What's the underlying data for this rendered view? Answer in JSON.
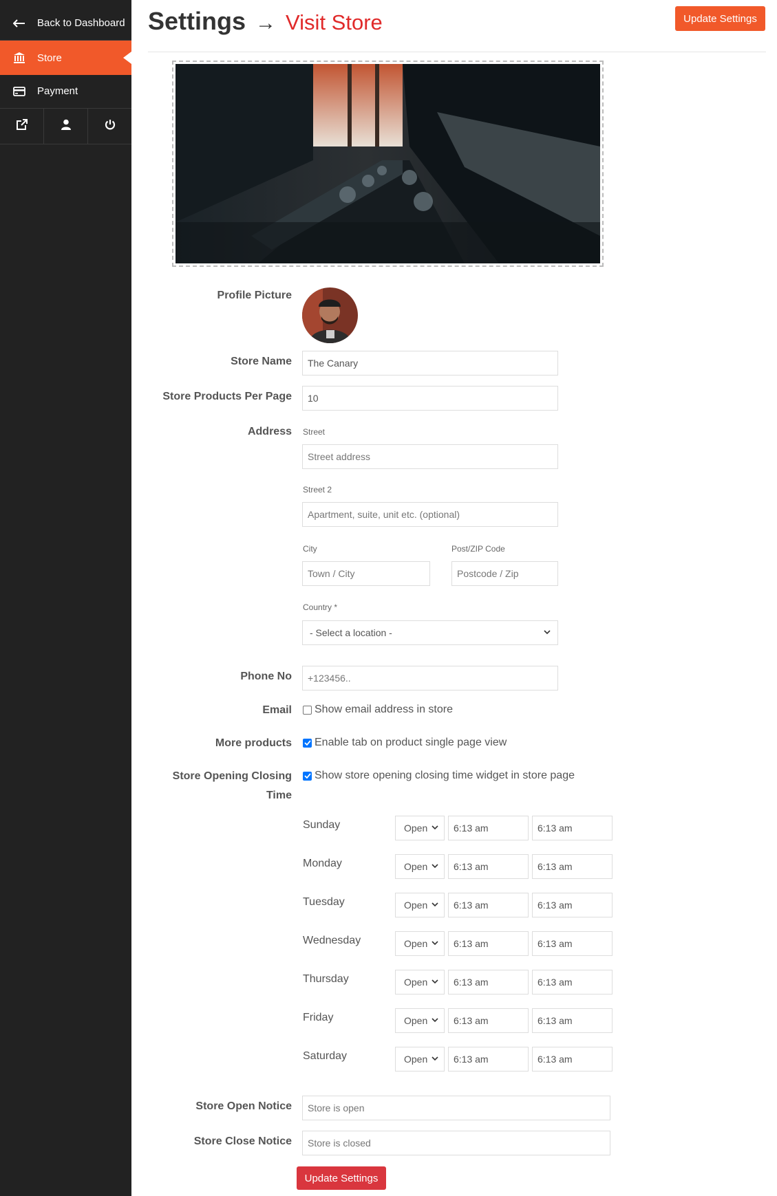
{
  "sidebar": {
    "back_label": "Back to Dashboard",
    "items": [
      {
        "label": "Store",
        "icon": "bank-icon",
        "active": true
      },
      {
        "label": "Payment",
        "icon": "credit-card-icon",
        "active": false
      }
    ],
    "icon_row": [
      "external-link-icon",
      "user-icon",
      "power-icon"
    ],
    "accent": "#f1592a",
    "bg": "#222222"
  },
  "header": {
    "title": "Settings",
    "arrow": "→",
    "visit_link": "Visit Store",
    "update_button": "Update Settings"
  },
  "form": {
    "profile_picture_label": "Profile Picture",
    "store_name_label": "Store Name",
    "store_name_value": "The Canary",
    "products_per_page_label": "Store Products Per Page",
    "products_per_page_value": "10",
    "address_label": "Address",
    "street_label": "Street",
    "street_placeholder": "Street address",
    "street2_label": "Street 2",
    "street2_placeholder": "Apartment, suite, unit etc. (optional)",
    "city_label": "City",
    "city_placeholder": "Town / City",
    "zip_label": "Post/ZIP Code",
    "zip_placeholder": "Postcode / Zip",
    "country_label": "Country *",
    "country_value": "- Select a location -",
    "phone_label": "Phone No",
    "phone_placeholder": "+123456..",
    "email_label": "Email",
    "email_checkbox": "Show email address in store",
    "email_checked": false,
    "more_products_label": "More products",
    "more_products_checkbox": "Enable tab on product single page view",
    "more_products_checked": true,
    "opening_label_line1": "Store Opening Closing",
    "opening_label_line2": "Time",
    "opening_checkbox": "Show store opening closing time widget in store page",
    "opening_checked": true,
    "days": [
      {
        "name": "Sunday",
        "status": "Open",
        "open": "6:13 am",
        "close": "6:13 am"
      },
      {
        "name": "Monday",
        "status": "Open",
        "open": "6:13 am",
        "close": "6:13 am"
      },
      {
        "name": "Tuesday",
        "status": "Open",
        "open": "6:13 am",
        "close": "6:13 am"
      },
      {
        "name": "Wednesday",
        "status": "Open",
        "open": "6:13 am",
        "close": "6:13 am"
      },
      {
        "name": "Thursday",
        "status": "Open",
        "open": "6:13 am",
        "close": "6:13 am"
      },
      {
        "name": "Friday",
        "status": "Open",
        "open": "6:13 am",
        "close": "6:13 am"
      },
      {
        "name": "Saturday",
        "status": "Open",
        "open": "6:13 am",
        "close": "6:13 am"
      }
    ],
    "open_notice_label": "Store Open Notice",
    "open_notice_placeholder": "Store is open",
    "close_notice_label": "Store Close Notice",
    "close_notice_placeholder": "Store is closed",
    "submit_button": "Update Settings"
  }
}
